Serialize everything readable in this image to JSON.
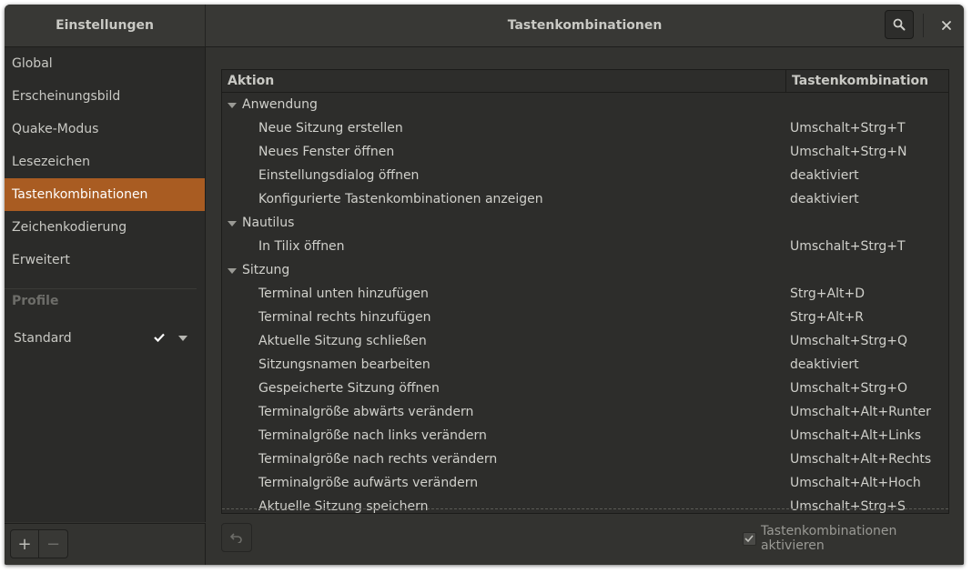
{
  "sidebar_header": {
    "title": "Einstellungen"
  },
  "header": {
    "title": "Tastenkombinationen"
  },
  "sidebar": {
    "items": [
      {
        "label": "Global"
      },
      {
        "label": "Erscheinungsbild"
      },
      {
        "label": "Quake-Modus"
      },
      {
        "label": "Lesezeichen"
      },
      {
        "label": "Tastenkombinationen",
        "active": true
      },
      {
        "label": "Zeichenkodierung"
      },
      {
        "label": "Erweitert"
      }
    ],
    "section_label": "Profile",
    "profiles": [
      {
        "label": "Standard",
        "default": true
      }
    ],
    "add_label": "+",
    "remove_label": "−"
  },
  "table": {
    "col_action": "Aktion",
    "col_combo": "Tastenkombination",
    "groups": [
      {
        "name": "Anwendung",
        "rows": [
          {
            "action": "Neue Sitzung erstellen",
            "combo": "Umschalt+Strg+T"
          },
          {
            "action": "Neues Fenster öffnen",
            "combo": "Umschalt+Strg+N"
          },
          {
            "action": "Einstellungsdialog öffnen",
            "combo": "deaktiviert"
          },
          {
            "action": "Konfigurierte Tastenkombinationen anzeigen",
            "combo": "deaktiviert"
          }
        ]
      },
      {
        "name": "Nautilus",
        "rows": [
          {
            "action": "In Tilix öffnen",
            "combo": "Umschalt+Strg+T"
          }
        ]
      },
      {
        "name": "Sitzung",
        "rows": [
          {
            "action": "Terminal unten hinzufügen",
            "combo": "Strg+Alt+D"
          },
          {
            "action": "Terminal rechts hinzufügen",
            "combo": "Strg+Alt+R"
          },
          {
            "action": "Aktuelle Sitzung schließen",
            "combo": "Umschalt+Strg+Q"
          },
          {
            "action": "Sitzungsnamen bearbeiten",
            "combo": "deaktiviert"
          },
          {
            "action": "Gespeicherte Sitzung öffnen",
            "combo": "Umschalt+Strg+O"
          },
          {
            "action": "Terminalgröße abwärts verändern",
            "combo": "Umschalt+Alt+Runter"
          },
          {
            "action": "Terminalgröße nach links verändern",
            "combo": "Umschalt+Alt+Links"
          },
          {
            "action": "Terminalgröße nach rechts verändern",
            "combo": "Umschalt+Alt+Rechts"
          },
          {
            "action": "Terminalgröße aufwärts verändern",
            "combo": "Umschalt+Alt+Hoch"
          },
          {
            "action": "Aktuelle Sitzung speichern",
            "combo": "Umschalt+Strg+S"
          }
        ]
      }
    ]
  },
  "footer": {
    "enable_label": "Tastenkombinationen aktivieren",
    "enable_checked": true
  },
  "icons": {
    "search": "search-icon",
    "close": "close-icon",
    "undo": "undo-icon",
    "check": "check-icon"
  },
  "colors": {
    "accent": "#a95c22"
  }
}
